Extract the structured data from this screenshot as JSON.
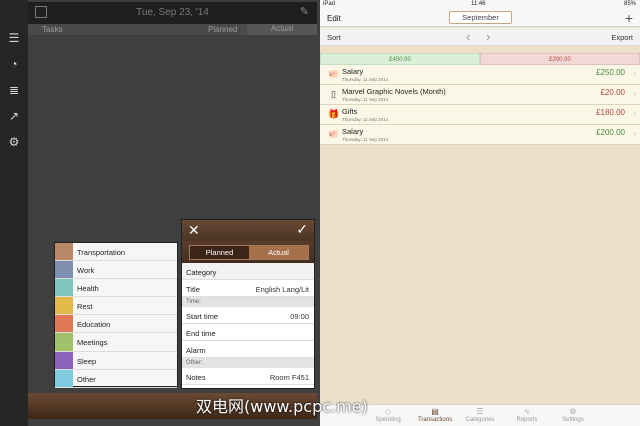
{
  "left": {
    "date": "Tue, Sep 23, '14",
    "columns": {
      "tasks": "Tasks",
      "planned": "Planned",
      "actual": "Actual"
    },
    "categories": [
      {
        "label": "Transportation",
        "color": "#b9896a"
      },
      {
        "label": "Work",
        "color": "#7e8fb0"
      },
      {
        "label": "Health",
        "color": "#7fc6c0"
      },
      {
        "label": "Rest",
        "color": "#e2b84a"
      },
      {
        "label": "Education",
        "color": "#e07a56"
      },
      {
        "label": "Meetings",
        "color": "#9fc26a"
      },
      {
        "label": "Sleep",
        "color": "#8a63b8"
      },
      {
        "label": "Other",
        "color": "#7ecbe0"
      }
    ],
    "editor": {
      "seg_planned": "Planned",
      "seg_actual": "Actual",
      "category": "Category",
      "title_label": "Title",
      "title_value": "English Lang/Lit",
      "time_section": "Time:",
      "start_label": "Start time",
      "start_value": "09:00",
      "end_label": "End time",
      "alarm_label": "Alarm",
      "other_section": "Other:",
      "notes_label": "Notes",
      "notes_value": "Room F451"
    }
  },
  "right": {
    "status": {
      "device": "iPad",
      "time": "11:46",
      "battery": "85%"
    },
    "nav": {
      "edit": "Edit",
      "month": "September",
      "add": "+"
    },
    "tools": {
      "sort": "Sort",
      "export": "Export"
    },
    "totals": {
      "income": "£450.00",
      "expense": "£200.00"
    },
    "transactions": [
      {
        "icon": "piggy-bank-icon",
        "glyph": "🐖",
        "title": "Salary",
        "date": "Thursday, 11 Sep 2014",
        "amount": "£250.00",
        "color": "#4a8a44"
      },
      {
        "icon": "ipod-icon",
        "glyph": "▯",
        "title": "Marvel Graphic Novels (Month)",
        "date": "Thursday, 11 Sep 2014",
        "amount": "£20.00",
        "color": "#b4463e"
      },
      {
        "icon": "gift-icon",
        "glyph": "🎁",
        "title": "Gifts",
        "date": "Thursday, 11 Sep 2014",
        "amount": "£180.00",
        "color": "#b4463e"
      },
      {
        "icon": "piggy-bank-icon",
        "glyph": "🐖",
        "title": "Salary",
        "date": "Thursday, 11 Sep 2014",
        "amount": "£200.00",
        "color": "#4a8a44"
      }
    ],
    "tabs": [
      {
        "label": "Spending",
        "glyph": "◇"
      },
      {
        "label": "Transactions",
        "glyph": "▤"
      },
      {
        "label": "Categories",
        "glyph": "☰"
      },
      {
        "label": "Reports",
        "glyph": "∿"
      },
      {
        "label": "Settings",
        "glyph": "⚙"
      }
    ]
  },
  "watermark": "双电网(www.pcpc.me)"
}
